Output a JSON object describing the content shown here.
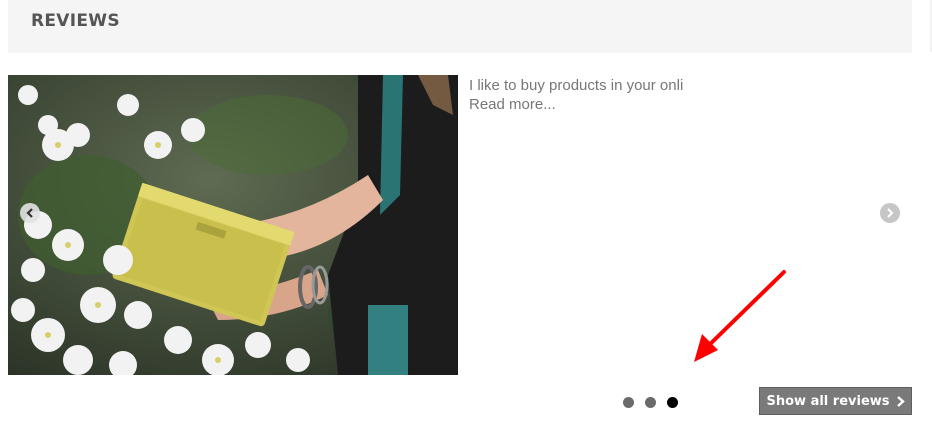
{
  "header": {
    "title": "REVIEWS"
  },
  "review": {
    "text": "I like to buy products in your onli",
    "read_more": "Read more..."
  },
  "carousel": {
    "prev_icon": "chevron-left-icon",
    "next_icon": "chevron-right-icon",
    "dot_count": 3,
    "active_index": 2
  },
  "buttons": {
    "show_all_label": "Show all reviews"
  },
  "annotation": {
    "color": "#ff0000",
    "icon": "red-arrow-icon"
  }
}
